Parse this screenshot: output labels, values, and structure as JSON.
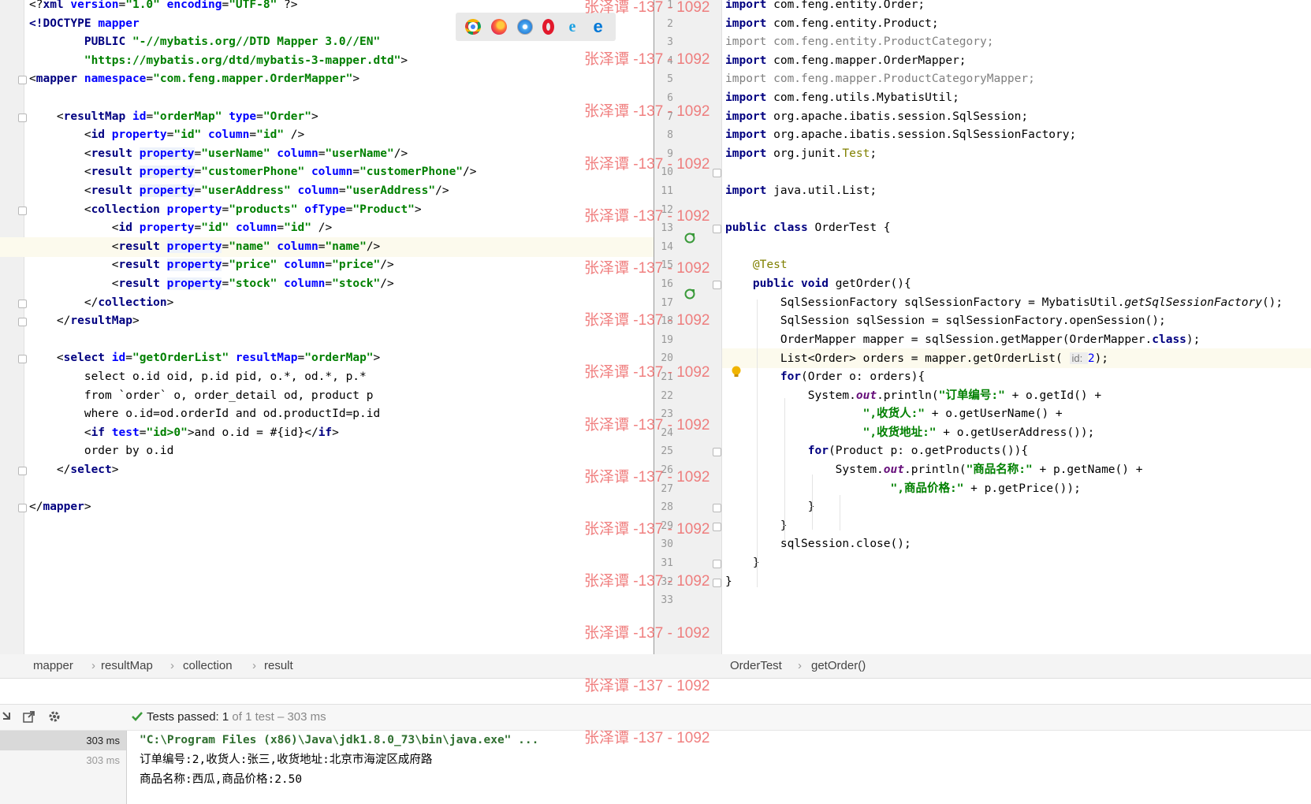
{
  "left_editor": {
    "lines": [
      {
        "parts": [
          [
            "p",
            "<?"
          ],
          [
            "t",
            "xml "
          ],
          [
            "a",
            "version"
          ],
          [
            "p",
            "="
          ],
          [
            "v",
            "\"1.0\" "
          ],
          [
            "a",
            "encoding"
          ],
          [
            "p",
            "="
          ],
          [
            "v",
            "\"UTF-8\" "
          ],
          [
            "p",
            "?>"
          ]
        ]
      },
      {
        "parts": [
          [
            "t",
            "<!DOCTYPE "
          ],
          [
            "a",
            "mapper"
          ]
        ]
      },
      {
        "parts": [
          [
            "p",
            "        "
          ],
          [
            "t",
            "PUBLIC "
          ],
          [
            "v",
            "\"-//mybatis.org//DTD Mapper 3.0//EN\""
          ]
        ]
      },
      {
        "parts": [
          [
            "p",
            "        "
          ],
          [
            "v",
            "\"https://mybatis.org/dtd/mybatis-3-mapper.dtd\""
          ],
          [
            "p",
            ">"
          ]
        ]
      },
      {
        "parts": [
          [
            "p",
            "<"
          ],
          [
            "t",
            "mapper "
          ],
          [
            "a",
            "namespace"
          ],
          [
            "p",
            "="
          ],
          [
            "v",
            "\"com.feng.mapper.OrderMapper\""
          ],
          [
            "p",
            ">"
          ]
        ]
      },
      {
        "parts": []
      },
      {
        "parts": [
          [
            "p",
            "    <"
          ],
          [
            "t",
            "resultMap "
          ],
          [
            "a",
            "id"
          ],
          [
            "p",
            "="
          ],
          [
            "v",
            "\"orderMap\" "
          ],
          [
            "a",
            "type"
          ],
          [
            "p",
            "="
          ],
          [
            "v",
            "\"Order\""
          ],
          [
            "p",
            ">"
          ]
        ]
      },
      {
        "parts": [
          [
            "p",
            "        <"
          ],
          [
            "t",
            "id "
          ],
          [
            "a",
            "property"
          ],
          [
            "p",
            "="
          ],
          [
            "v",
            "\"id\" "
          ],
          [
            "a",
            "column"
          ],
          [
            "p",
            "="
          ],
          [
            "v",
            "\"id\" "
          ],
          [
            "p",
            "/>"
          ]
        ]
      },
      {
        "parts": [
          [
            "p",
            "        <"
          ],
          [
            "t",
            "result "
          ],
          [
            "ab",
            "property"
          ],
          [
            "p",
            "="
          ],
          [
            "v",
            "\"userName\" "
          ],
          [
            "a",
            "column"
          ],
          [
            "p",
            "="
          ],
          [
            "v",
            "\"userName\""
          ],
          [
            "p",
            "/>"
          ]
        ]
      },
      {
        "parts": [
          [
            "p",
            "        <"
          ],
          [
            "t",
            "result "
          ],
          [
            "ab",
            "property"
          ],
          [
            "p",
            "="
          ],
          [
            "v",
            "\"customerPhone\" "
          ],
          [
            "a",
            "column"
          ],
          [
            "p",
            "="
          ],
          [
            "v",
            "\"customerPhone\""
          ],
          [
            "p",
            "/>"
          ]
        ]
      },
      {
        "parts": [
          [
            "p",
            "        <"
          ],
          [
            "t",
            "result "
          ],
          [
            "ab",
            "property"
          ],
          [
            "p",
            "="
          ],
          [
            "v",
            "\"userAddress\" "
          ],
          [
            "a",
            "column"
          ],
          [
            "p",
            "="
          ],
          [
            "v",
            "\"userAddress\""
          ],
          [
            "p",
            "/>"
          ]
        ]
      },
      {
        "parts": [
          [
            "p",
            "        <"
          ],
          [
            "t",
            "collection "
          ],
          [
            "a",
            "property"
          ],
          [
            "p",
            "="
          ],
          [
            "v",
            "\"products\" "
          ],
          [
            "a",
            "ofType"
          ],
          [
            "p",
            "="
          ],
          [
            "v",
            "\"Product\""
          ],
          [
            "p",
            ">"
          ]
        ]
      },
      {
        "parts": [
          [
            "p",
            "            <"
          ],
          [
            "t",
            "id "
          ],
          [
            "a",
            "property"
          ],
          [
            "p",
            "="
          ],
          [
            "v",
            "\"id\" "
          ],
          [
            "a",
            "column"
          ],
          [
            "p",
            "="
          ],
          [
            "v",
            "\"id\" "
          ],
          [
            "p",
            "/>"
          ]
        ]
      },
      {
        "parts": [
          [
            "p",
            "            <"
          ],
          [
            "t",
            "result "
          ],
          [
            "ab",
            "property"
          ],
          [
            "p",
            "="
          ],
          [
            "v",
            "\"name\" "
          ],
          [
            "a",
            "column"
          ],
          [
            "p",
            "="
          ],
          [
            "v",
            "\"name\""
          ],
          [
            "p",
            "/>"
          ]
        ],
        "highlight": true
      },
      {
        "parts": [
          [
            "p",
            "            <"
          ],
          [
            "t",
            "result "
          ],
          [
            "ab",
            "property"
          ],
          [
            "p",
            "="
          ],
          [
            "v",
            "\"price\" "
          ],
          [
            "a",
            "column"
          ],
          [
            "p",
            "="
          ],
          [
            "v",
            "\"price\""
          ],
          [
            "p",
            "/>"
          ]
        ]
      },
      {
        "parts": [
          [
            "p",
            "            <"
          ],
          [
            "t",
            "result "
          ],
          [
            "ab",
            "property"
          ],
          [
            "p",
            "="
          ],
          [
            "v",
            "\"stock\" "
          ],
          [
            "a",
            "column"
          ],
          [
            "p",
            "="
          ],
          [
            "v",
            "\"stock\""
          ],
          [
            "p",
            "/>"
          ]
        ]
      },
      {
        "parts": [
          [
            "p",
            "        </"
          ],
          [
            "t",
            "collection"
          ],
          [
            "p",
            ">"
          ]
        ]
      },
      {
        "parts": [
          [
            "p",
            "    </"
          ],
          [
            "t",
            "resultMap"
          ],
          [
            "p",
            ">"
          ]
        ]
      },
      {
        "parts": []
      },
      {
        "parts": [
          [
            "p",
            "    <"
          ],
          [
            "t",
            "select "
          ],
          [
            "a",
            "id"
          ],
          [
            "p",
            "="
          ],
          [
            "v",
            "\"getOrderList\" "
          ],
          [
            "a",
            "resultMap"
          ],
          [
            "p",
            "="
          ],
          [
            "v",
            "\"orderMap\""
          ],
          [
            "p",
            ">"
          ]
        ]
      },
      {
        "parts": [
          [
            "p",
            "        select o.id oid, p.id pid, o.*, od.*, p.*"
          ]
        ]
      },
      {
        "parts": [
          [
            "p",
            "        from `order` o, order_detail od, product p"
          ]
        ]
      },
      {
        "parts": [
          [
            "p",
            "        where o.id=od.orderId and od.productId=p.id"
          ]
        ]
      },
      {
        "parts": [
          [
            "p",
            "        <"
          ],
          [
            "t",
            "if "
          ],
          [
            "a",
            "test"
          ],
          [
            "p",
            "="
          ],
          [
            "v",
            "\"id>0\""
          ],
          [
            "p",
            ">and o.id = #{id}</"
          ],
          [
            "t",
            "if"
          ],
          [
            "p",
            ">"
          ]
        ]
      },
      {
        "parts": [
          [
            "p",
            "        order by o.id"
          ]
        ]
      },
      {
        "parts": [
          [
            "p",
            "    </"
          ],
          [
            "t",
            "select"
          ],
          [
            "p",
            ">"
          ]
        ]
      },
      {
        "parts": []
      },
      {
        "parts": [
          [
            "p",
            "</"
          ],
          [
            "t",
            "mapper"
          ],
          [
            "p",
            ">"
          ]
        ]
      }
    ]
  },
  "browser_icons": [
    "chrome-icon",
    "firefox-icon",
    "safari-icon",
    "opera-icon",
    "ie-icon",
    "edge-icon"
  ],
  "right_editor": {
    "line_numbers": [
      "1",
      "2",
      "3",
      "4",
      "5",
      "6",
      "7",
      "8",
      "9",
      "10",
      "11",
      "12",
      "13",
      "14",
      "15",
      "16",
      "17",
      "18",
      "19",
      "20",
      "21",
      "22",
      "23",
      "24",
      "25",
      "26",
      "27",
      "28",
      "29",
      "30",
      "31",
      "32",
      "33"
    ],
    "lines": [
      {
        "parts": [
          [
            "kw",
            "import "
          ],
          [
            "p",
            "com.feng.entity.Order;"
          ]
        ]
      },
      {
        "parts": [
          [
            "kw",
            "import "
          ],
          [
            "p",
            "com.feng.entity.Product;"
          ]
        ]
      },
      {
        "parts": [
          [
            "gray",
            "import com.feng.entity.ProductCategory;"
          ]
        ]
      },
      {
        "parts": [
          [
            "kw",
            "import "
          ],
          [
            "p",
            "com.feng.mapper.OrderMapper;"
          ]
        ]
      },
      {
        "parts": [
          [
            "gray",
            "import com.feng.mapper.ProductCategoryMapper;"
          ]
        ]
      },
      {
        "parts": [
          [
            "kw",
            "import "
          ],
          [
            "p",
            "com.feng.utils.MybatisUtil;"
          ]
        ]
      },
      {
        "parts": [
          [
            "kw",
            "import "
          ],
          [
            "p",
            "org.apache.ibatis.session.SqlSession;"
          ]
        ]
      },
      {
        "parts": [
          [
            "kw",
            "import "
          ],
          [
            "p",
            "org.apache.ibatis.session.SqlSessionFactory;"
          ]
        ]
      },
      {
        "parts": [
          [
            "kw",
            "import "
          ],
          [
            "p",
            "org.junit."
          ],
          [
            "anno",
            "Test"
          ],
          [
            "p",
            ";"
          ]
        ]
      },
      {
        "parts": []
      },
      {
        "parts": [
          [
            "kw",
            "import "
          ],
          [
            "p",
            "java.util.List;"
          ]
        ]
      },
      {
        "parts": []
      },
      {
        "parts": [
          [
            "kw",
            "public class "
          ],
          [
            "p",
            "OrderTest {"
          ]
        ]
      },
      {
        "parts": []
      },
      {
        "parts": [
          [
            "p",
            "    "
          ],
          [
            "anno",
            "@Test"
          ]
        ]
      },
      {
        "parts": [
          [
            "p",
            "    "
          ],
          [
            "kw",
            "public void "
          ],
          [
            "p",
            "getOrder(){"
          ]
        ]
      },
      {
        "parts": [
          [
            "p",
            "        SqlSessionFactory sqlSessionFactory = MybatisUtil."
          ],
          [
            "ital",
            "getSqlSessionFactory"
          ],
          [
            "p",
            "();"
          ]
        ]
      },
      {
        "parts": [
          [
            "p",
            "        SqlSession sqlSession = sqlSessionFactory.openSession();"
          ]
        ]
      },
      {
        "parts": [
          [
            "p",
            "        OrderMapper mapper = sqlSession.getMapper(OrderMapper."
          ],
          [
            "kw",
            "class"
          ],
          [
            "p",
            ");"
          ]
        ]
      },
      {
        "parts": [
          [
            "p",
            "        List<Order> orders = mapper.getOrderList( "
          ],
          [
            "hint",
            "id: "
          ],
          [
            "hintnum",
            "2"
          ],
          [
            "p",
            ");"
          ]
        ],
        "highlight": true
      },
      {
        "parts": [
          [
            "p",
            "        "
          ],
          [
            "kw",
            "for"
          ],
          [
            "p",
            "(Order o: orders){"
          ]
        ]
      },
      {
        "parts": [
          [
            "p",
            "            System."
          ],
          [
            "fld",
            "out"
          ],
          [
            "p",
            ".println("
          ],
          [
            "str",
            "\"订单编号:\" "
          ],
          [
            "p",
            "+ o.getId() +"
          ]
        ]
      },
      {
        "parts": [
          [
            "p",
            "                    "
          ],
          [
            "str",
            "\",收货人:\" "
          ],
          [
            "p",
            "+ o.getUserName() +"
          ]
        ]
      },
      {
        "parts": [
          [
            "p",
            "                    "
          ],
          [
            "str",
            "\",收货地址:\" "
          ],
          [
            "p",
            "+ o.getUserAddress());"
          ]
        ]
      },
      {
        "parts": [
          [
            "p",
            "            "
          ],
          [
            "kw",
            "for"
          ],
          [
            "p",
            "(Product p: o.getProducts()){"
          ]
        ]
      },
      {
        "parts": [
          [
            "p",
            "                System."
          ],
          [
            "fld",
            "out"
          ],
          [
            "p",
            ".println("
          ],
          [
            "str",
            "\"商品名称:\" "
          ],
          [
            "p",
            "+ p.getName() +"
          ]
        ]
      },
      {
        "parts": [
          [
            "p",
            "                        "
          ],
          [
            "str",
            "\",商品价格:\" "
          ],
          [
            "p",
            "+ p.getPrice());"
          ]
        ]
      },
      {
        "parts": [
          [
            "p",
            "            }"
          ]
        ]
      },
      {
        "parts": [
          [
            "p",
            "        }"
          ]
        ]
      },
      {
        "parts": [
          [
            "p",
            "        sqlSession.close();"
          ]
        ]
      },
      {
        "parts": [
          [
            "p",
            "    }"
          ]
        ]
      },
      {
        "parts": [
          [
            "p",
            "}"
          ]
        ]
      },
      {
        "parts": []
      }
    ]
  },
  "breadcrumbs_left": [
    "mapper",
    "resultMap",
    "collection",
    "result"
  ],
  "breadcrumbs_right": [
    "OrderTest",
    "getOrder()"
  ],
  "run_panel": {
    "status_prefix": "Tests passed:",
    "status_count": "1",
    "status_suffix": "of 1 test – 303 ms",
    "times": [
      "303 ms",
      "303 ms"
    ],
    "output": [
      "\"C:\\Program Files (x86)\\Java\\jdk1.8.0_73\\bin\\java.exe\" ...",
      "订单编号:2,收货人:张三,收货地址:北京市海淀区成府路",
      "商品名称:西瓜,商品价格:2.50"
    ]
  },
  "watermark": "张泽谭 -137 - 1092",
  "colors": {
    "tag": "#000080",
    "attr": "#0000ff",
    "value": "#008000",
    "highlight_line": "#fcfaed",
    "watermark": "#ee6b6b",
    "pass": "#3a9a3a"
  }
}
